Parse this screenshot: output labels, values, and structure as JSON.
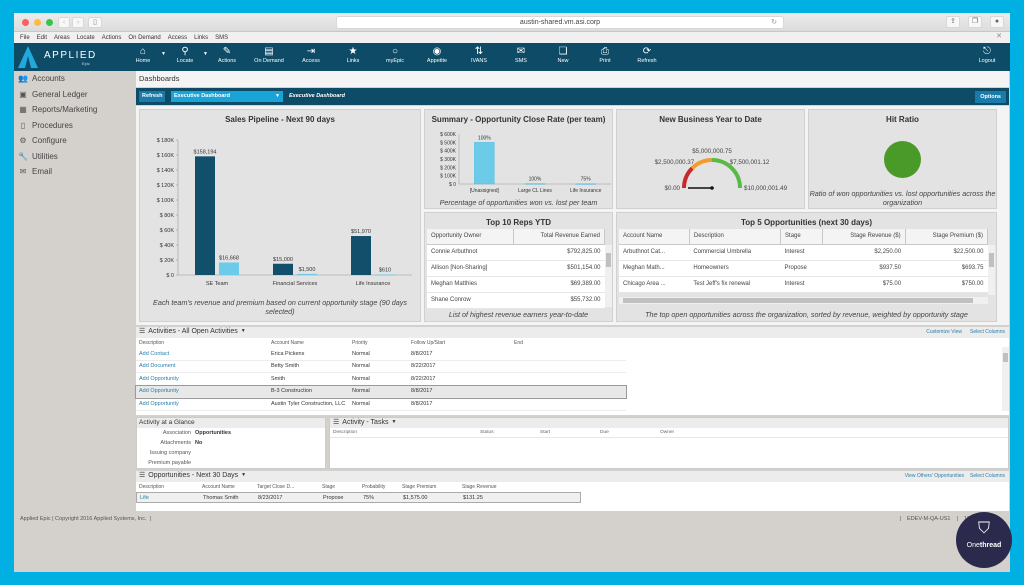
{
  "browser": {
    "url": "austin-shared.vm.asi.corp",
    "traffic_colors": [
      "#fc605c",
      "#fdbc40",
      "#34c84a"
    ]
  },
  "menu": [
    "File",
    "Edit",
    "Areas",
    "Locate",
    "Actions",
    "On Demand",
    "Access",
    "Links",
    "SMS"
  ],
  "app": {
    "logo_text": "APPLIED",
    "logo_sub": "Epic",
    "toolbar": [
      {
        "label": "Home",
        "icon": "⌂",
        "name": "home",
        "dropdown": true
      },
      {
        "label": "Locate",
        "icon": "⚲",
        "name": "locate",
        "dropdown": true
      },
      {
        "label": "Actions",
        "icon": "✎",
        "name": "actions",
        "dropdown": false
      },
      {
        "label": "On Demand",
        "icon": "▤",
        "name": "on-demand",
        "dropdown": false
      },
      {
        "label": "Access",
        "icon": "⇥",
        "name": "access",
        "dropdown": false
      },
      {
        "label": "Links",
        "icon": "★",
        "name": "links",
        "dropdown": false
      },
      {
        "label": "myEpic",
        "icon": "○",
        "name": "myepic",
        "dropdown": false
      },
      {
        "label": "Appetite",
        "icon": "◉",
        "name": "appetite",
        "dropdown": false
      },
      {
        "label": "IVANS",
        "icon": "⇅",
        "name": "ivans",
        "dropdown": false
      },
      {
        "label": "SMS",
        "icon": "✉",
        "name": "sms",
        "dropdown": false
      },
      {
        "label": "New",
        "icon": "❏",
        "name": "new",
        "dropdown": false
      },
      {
        "label": "Print",
        "icon": "⎙",
        "name": "print",
        "dropdown": false
      },
      {
        "label": "Refresh",
        "icon": "⟳",
        "name": "refresh",
        "dropdown": false
      }
    ],
    "logout_label": "Logout"
  },
  "sidebar": [
    {
      "label": "Accounts",
      "icon": "👥",
      "name": "accounts"
    },
    {
      "label": "General Ledger",
      "icon": "▣",
      "name": "general-ledger"
    },
    {
      "label": "Reports/Marketing",
      "icon": "▦",
      "name": "reports-marketing"
    },
    {
      "label": "Procedures",
      "icon": "▯",
      "name": "procedures"
    },
    {
      "label": "Configure",
      "icon": "⚙",
      "name": "configure"
    },
    {
      "label": "Utilities",
      "icon": "🔧",
      "name": "utilities"
    },
    {
      "label": "Email",
      "icon": "✉",
      "name": "email"
    }
  ],
  "dashboard": {
    "title": "Dashboards",
    "refresh_label": "Refresh",
    "selected_dashboard": "Executive Dashboard",
    "dashboard_name": "Executive Dashboard",
    "options_label": "Options"
  },
  "chart_data": [
    {
      "type": "bar",
      "title": "Sales Pipeline - Next 90 days",
      "categories": [
        "SE Team",
        "Financial Services",
        "Life Insurance"
      ],
      "series": [
        {
          "name": "Revenue",
          "color": "#114f6b",
          "values": [
            158194,
            15000,
            51970
          ]
        },
        {
          "name": "Premium",
          "color": "#6ccbe9",
          "values": [
            16668,
            1500,
            610
          ]
        }
      ],
      "data_labels": [
        [
          "$158,194",
          "$16,668"
        ],
        [
          "$15,000",
          "$1,500"
        ],
        [
          "$51,970",
          "$610"
        ]
      ],
      "yticks": [
        "$ 0",
        "$ 20K",
        "$ 40K",
        "$ 60K",
        "$ 80K",
        "$ 100K",
        "$ 120K",
        "$ 140K",
        "$ 160K",
        "$ 180K"
      ],
      "ylim": [
        0,
        180000
      ],
      "caption": "Each team's revenue and premium based on current opportunity stage (90 days selected)"
    },
    {
      "type": "bar",
      "title": "Summary - Opportunity Close Rate (per team)",
      "categories": [
        "[Unassigned]",
        "Large CL Lines",
        "Life Insurance"
      ],
      "values": [
        500000,
        5000,
        4000
      ],
      "data_labels": [
        "100%",
        "100%",
        "75%"
      ],
      "yticks": [
        "$ 0",
        "$ 100K",
        "$ 200K",
        "$ 300K",
        "$ 400K",
        "$ 500K",
        "$ 600K"
      ],
      "ylim": [
        0,
        600000
      ],
      "color": "#6ccbe9",
      "caption": "Percentage of opportunities won vs. lost per team"
    },
    {
      "type": "gauge",
      "title": "New Business Year to Date",
      "min_label": "$0.00",
      "q1_label": "$2,500,000.37",
      "mid_label": "$5,000,000.75",
      "q3_label": "$7,500,001.12",
      "max_label": "$10,000,001.49",
      "range": [
        0,
        10000001.49
      ],
      "value": 0,
      "bands": [
        {
          "from": 0,
          "to": 2500000.37,
          "color": "#c62a2a"
        },
        {
          "from": 2500000.37,
          "to": 5000000.75,
          "color": "#f39c2b"
        },
        {
          "from": 5000000.75,
          "to": 10000001.49,
          "color": "#5aba47"
        }
      ]
    },
    {
      "type": "indicator",
      "title": "Hit Ratio",
      "color": "#4a9a2a",
      "caption": "Ratio of won opportunities vs. lost opportunities across the organization"
    }
  ],
  "top_reps": {
    "title": "Top 10 Reps YTD",
    "columns": [
      "Opportunity Owner",
      "Total Revenue Earned"
    ],
    "rows": [
      [
        "Connie Arbuthnot",
        "$792,825.00"
      ],
      [
        "Allison [Non-Sharing]",
        "$501,154.00"
      ],
      [
        "Meghan Matthies",
        "$69,389.00"
      ],
      [
        "Shane Conrow",
        "$55,732.00"
      ]
    ],
    "caption": "List of highest revenue earners year-to-date"
  },
  "top_opps": {
    "title": "Top 5 Opportunities (next 30 days)",
    "columns": [
      "Account Name",
      "Description",
      "Stage",
      "Stage Revenue ($)",
      "Stage Premium ($)"
    ],
    "rows": [
      [
        "Arbuthnot Cat...",
        "Commercial Umbrella",
        "Interest",
        "$2,250.00",
        "$22,500.00"
      ],
      [
        "Meghan Math...",
        "Homeowners",
        "Propose",
        "$937.50",
        "$693.75"
      ],
      [
        "Chicago Area ...",
        "Test Jeff's fix renewal",
        "Interest",
        "$75.00",
        "$750.00"
      ]
    ],
    "caption": "The top open opportunities across the organization, sorted by revenue, weighted by opportunity stage"
  },
  "activities": {
    "title": "Activities - All Open Activities",
    "customize_label": "Customize View",
    "select_columns_label": "Select Columns",
    "columns": [
      "Description",
      "Account Name",
      "Priority",
      "Follow Up/Start",
      "End"
    ],
    "rows": [
      [
        "Add Contact",
        "Erica Pickens",
        "Normal",
        "8/8/2017",
        ""
      ],
      [
        "Add Document",
        "Betty Smith",
        "Normal",
        "8/22/2017",
        ""
      ],
      [
        "Add Opportunity",
        "Smith",
        "Normal",
        "8/22/2017",
        ""
      ],
      [
        "Add Opportunity",
        "B-3 Construction",
        "Normal",
        "8/8/2017",
        ""
      ],
      [
        "Add Opportunity",
        "Austin Tyler Construction, LLC",
        "Normal",
        "8/8/2017",
        ""
      ]
    ],
    "selected_row": 3
  },
  "glance": {
    "title": "Activity at a Glance",
    "fields": [
      {
        "key": "Association",
        "value": "Opportunities"
      },
      {
        "key": "Attachments",
        "value": "No"
      },
      {
        "key": "Issuing company",
        "value": ""
      },
      {
        "key": "Premium payable",
        "value": ""
      }
    ]
  },
  "tasks": {
    "title": "Activity - Tasks",
    "columns": [
      "Description",
      "Status",
      "Start",
      "Due",
      "Owner"
    ]
  },
  "opportunities": {
    "title": "Opportunities - Next 30 Days",
    "view_others_label": "View Others' Opportunities",
    "select_columns_label": "Select Columns",
    "columns": [
      "Description",
      "Account Name",
      "Target Close D...",
      "Stage",
      "Probability",
      "Stage Premium",
      "Stage Revenue"
    ],
    "rows": [
      [
        "Life",
        "Thomas Smith",
        "8/23/2017",
        "Propose",
        "75%",
        "$1,575.00",
        "$131.25"
      ]
    ]
  },
  "footer": {
    "copyright": "Applied Epic | Copyright 2016 Applied Systems, Inc.",
    "server": "EDEV-M-QA-US1",
    "extra": "16"
  },
  "watermark": {
    "label_a": "One",
    "label_b": "thread"
  }
}
